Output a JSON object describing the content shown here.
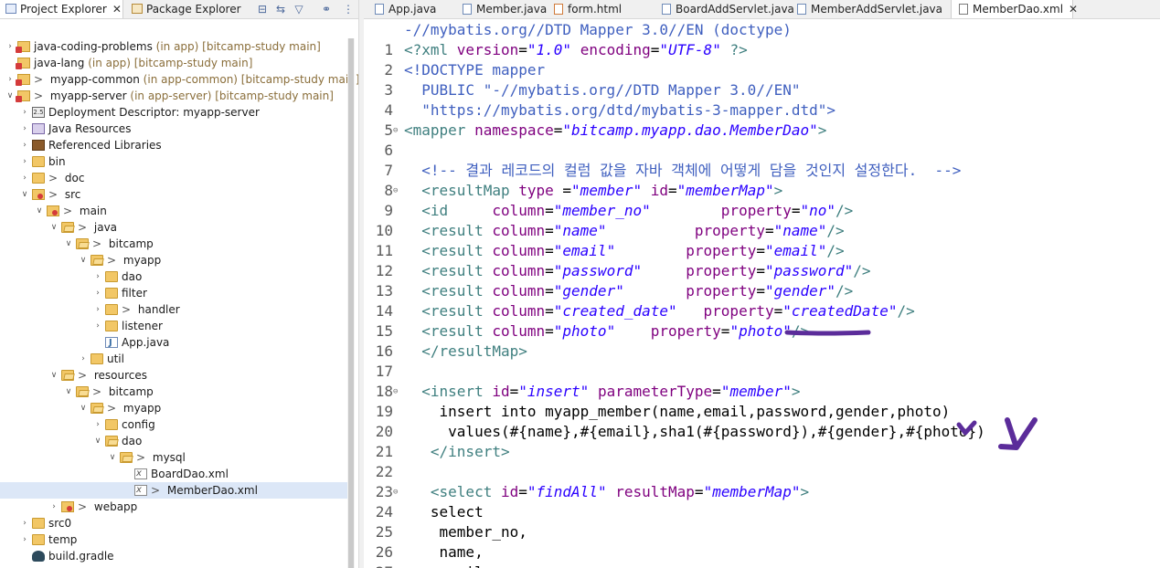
{
  "left_tabs": {
    "project_explorer": "Project Explorer",
    "package_explorer": "Package Explorer",
    "close": "✕"
  },
  "tree": [
    {
      "label": "java-coding-problems",
      "deco": " (in app) [bitcamp-study main]",
      "icon": "project-icon",
      "expand": "collapsed",
      "depth": 0,
      "prefix": ""
    },
    {
      "label": "java-lang",
      "deco": " (in app) [bitcamp-study main]",
      "icon": "project-icon",
      "expand": "none",
      "depth": 0,
      "prefix": ""
    },
    {
      "label": "myapp-common",
      "deco": " (in app-common) [bitcamp-study main]",
      "icon": "project-icon",
      "expand": "collapsed",
      "depth": 0,
      "prefix": "> "
    },
    {
      "label": "myapp-server",
      "deco": " (in app-server) [bitcamp-study main]",
      "icon": "project-icon",
      "expand": "expanded",
      "depth": 0,
      "prefix": "> "
    },
    {
      "label": "Deployment Descriptor: myapp-server",
      "deco": "",
      "icon": "deployment-descriptor-icon",
      "expand": "collapsed",
      "depth": 1,
      "prefix": ""
    },
    {
      "label": "Java Resources",
      "deco": "",
      "icon": "java-resources-icon",
      "expand": "collapsed",
      "depth": 1,
      "prefix": ""
    },
    {
      "label": "Referenced Libraries",
      "deco": "",
      "icon": "library-icon",
      "expand": "collapsed",
      "depth": 1,
      "prefix": ""
    },
    {
      "label": "bin",
      "deco": "",
      "icon": "folder-icon",
      "expand": "collapsed",
      "depth": 1,
      "prefix": ""
    },
    {
      "label": "doc",
      "deco": "",
      "icon": "folder-icon",
      "expand": "collapsed",
      "depth": 1,
      "prefix": "> "
    },
    {
      "label": "src",
      "deco": "",
      "icon": "source-folder-icon",
      "expand": "expanded",
      "depth": 1,
      "prefix": "> "
    },
    {
      "label": "main",
      "deco": "",
      "icon": "source-folder-icon",
      "expand": "expanded",
      "depth": 2,
      "prefix": "> "
    },
    {
      "label": "java",
      "deco": "",
      "icon": "folder-open-icon",
      "expand": "expanded",
      "depth": 3,
      "prefix": "> "
    },
    {
      "label": "bitcamp",
      "deco": "",
      "icon": "folder-open-icon",
      "expand": "expanded",
      "depth": 4,
      "prefix": "> "
    },
    {
      "label": "myapp",
      "deco": "",
      "icon": "folder-open-icon",
      "expand": "expanded",
      "depth": 5,
      "prefix": "> "
    },
    {
      "label": "dao",
      "deco": "",
      "icon": "folder-icon",
      "expand": "collapsed",
      "depth": 6,
      "prefix": ""
    },
    {
      "label": "filter",
      "deco": "",
      "icon": "folder-icon",
      "expand": "collapsed",
      "depth": 6,
      "prefix": ""
    },
    {
      "label": "handler",
      "deco": "",
      "icon": "folder-icon",
      "expand": "collapsed",
      "depth": 6,
      "prefix": "> "
    },
    {
      "label": "listener",
      "deco": "",
      "icon": "folder-icon",
      "expand": "collapsed",
      "depth": 6,
      "prefix": ""
    },
    {
      "label": "App.java",
      "deco": "",
      "icon": "java-file-icon",
      "expand": "none",
      "depth": 6,
      "prefix": ""
    },
    {
      "label": "util",
      "deco": "",
      "icon": "folder-icon",
      "expand": "collapsed",
      "depth": 5,
      "prefix": ""
    },
    {
      "label": "resources",
      "deco": "",
      "icon": "folder-open-icon",
      "expand": "expanded",
      "depth": 3,
      "prefix": "> "
    },
    {
      "label": "bitcamp",
      "deco": "",
      "icon": "folder-open-icon",
      "expand": "expanded",
      "depth": 4,
      "prefix": "> "
    },
    {
      "label": "myapp",
      "deco": "",
      "icon": "folder-open-icon",
      "expand": "expanded",
      "depth": 5,
      "prefix": "> "
    },
    {
      "label": "config",
      "deco": "",
      "icon": "folder-icon",
      "expand": "collapsed",
      "depth": 6,
      "prefix": ""
    },
    {
      "label": "dao",
      "deco": "",
      "icon": "folder-open-icon",
      "expand": "expanded",
      "depth": 6,
      "prefix": ""
    },
    {
      "label": "mysql",
      "deco": "",
      "icon": "folder-open-icon",
      "expand": "expanded",
      "depth": 7,
      "prefix": "> "
    },
    {
      "label": "BoardDao.xml",
      "deco": "",
      "icon": "xml-file-icon",
      "expand": "none",
      "depth": 8,
      "prefix": ""
    },
    {
      "label": "MemberDao.xml",
      "deco": "",
      "icon": "xml-file-icon",
      "expand": "none",
      "depth": 8,
      "prefix": "> ",
      "selected": true
    },
    {
      "label": "webapp",
      "deco": "",
      "icon": "source-folder-icon",
      "expand": "collapsed",
      "depth": 3,
      "prefix": "> "
    },
    {
      "label": "src0",
      "deco": "",
      "icon": "folder-icon",
      "expand": "collapsed",
      "depth": 1,
      "prefix": ""
    },
    {
      "label": "temp",
      "deco": "",
      "icon": "folder-icon",
      "expand": "collapsed",
      "depth": 1,
      "prefix": ""
    },
    {
      "label": "build.gradle",
      "deco": "",
      "icon": "gradle-file-icon",
      "expand": "none",
      "depth": 1,
      "prefix": ""
    }
  ],
  "editor_tabs": [
    {
      "label": "App.java",
      "type": "java",
      "active": false
    },
    {
      "label": "Member.java",
      "type": "java",
      "active": false
    },
    {
      "label": "form.html",
      "type": "html",
      "active": false
    },
    {
      "label": "BoardAddServlet.java",
      "type": "java",
      "active": false
    },
    {
      "label": "MemberAddServlet.java",
      "type": "java",
      "active": false
    },
    {
      "label": "MemberDao.xml",
      "type": "xml",
      "active": true
    }
  ],
  "editor_tab_close": "✕",
  "sticky_header": "-//mybatis.org//DTD Mapper 3.0//EN (doctype)",
  "code_lines": [
    {
      "n": "1",
      "fold": "",
      "segs": [
        [
          "tag",
          "<?xml "
        ],
        [
          "attr",
          "version"
        ],
        [
          "txt",
          "="
        ],
        [
          "val",
          "\"1.0\""
        ],
        [
          "txt",
          " "
        ],
        [
          "attr",
          "encoding"
        ],
        [
          "txt",
          "="
        ],
        [
          "val",
          "\"UTF-8\""
        ],
        [
          "tag",
          " ?>"
        ]
      ]
    },
    {
      "n": "2",
      "fold": "",
      "segs": [
        [
          "dt",
          "<!DOCTYPE mapper"
        ]
      ]
    },
    {
      "n": "3",
      "fold": "",
      "segs": [
        [
          "dt",
          "  PUBLIC \"-//mybatis.org//DTD Mapper 3.0//EN\""
        ]
      ]
    },
    {
      "n": "4",
      "fold": "",
      "segs": [
        [
          "dt",
          "  \"https://mybatis.org/dtd/mybatis-3-mapper.dtd\">"
        ]
      ]
    },
    {
      "n": "5",
      "fold": "⊖",
      "segs": [
        [
          "tag",
          "<mapper "
        ],
        [
          "attr",
          "namespace"
        ],
        [
          "txt",
          "="
        ],
        [
          "val",
          "\"bitcamp.myapp.dao.MemberDao\""
        ],
        [
          "tag",
          ">"
        ]
      ]
    },
    {
      "n": "6",
      "fold": "",
      "segs": [
        [
          "txt",
          ""
        ]
      ]
    },
    {
      "n": "7",
      "fold": "",
      "segs": [
        [
          "cm",
          "  <!-- 결과 레코드의 컬럼 값을 자바 객체에 어떻게 담을 것인지 설정한다.  -->"
        ]
      ]
    },
    {
      "n": "8",
      "fold": "⊖",
      "segs": [
        [
          "tag",
          "  <resultMap "
        ],
        [
          "attr",
          "type "
        ],
        [
          "txt",
          "="
        ],
        [
          "val",
          "\"member\""
        ],
        [
          "txt",
          " "
        ],
        [
          "attr",
          "id"
        ],
        [
          "txt",
          "="
        ],
        [
          "val",
          "\"memberMap\""
        ],
        [
          "tag",
          ">"
        ]
      ]
    },
    {
      "n": "9",
      "fold": "",
      "segs": [
        [
          "tag",
          "  <id     "
        ],
        [
          "attr",
          "column"
        ],
        [
          "txt",
          "="
        ],
        [
          "val",
          "\"member_no\""
        ],
        [
          "txt",
          "        "
        ],
        [
          "attr",
          "property"
        ],
        [
          "txt",
          "="
        ],
        [
          "val",
          "\"no\""
        ],
        [
          "tag",
          "/>"
        ]
      ]
    },
    {
      "n": "10",
      "fold": "",
      "segs": [
        [
          "tag",
          "  <result "
        ],
        [
          "attr",
          "column"
        ],
        [
          "txt",
          "="
        ],
        [
          "val",
          "\"name\""
        ],
        [
          "txt",
          "          "
        ],
        [
          "attr",
          "property"
        ],
        [
          "txt",
          "="
        ],
        [
          "val",
          "\"name\""
        ],
        [
          "tag",
          "/>"
        ]
      ]
    },
    {
      "n": "11",
      "fold": "",
      "segs": [
        [
          "tag",
          "  <result "
        ],
        [
          "attr",
          "column"
        ],
        [
          "txt",
          "="
        ],
        [
          "val",
          "\"email\""
        ],
        [
          "txt",
          "        "
        ],
        [
          "attr",
          "property"
        ],
        [
          "txt",
          "="
        ],
        [
          "val",
          "\"email\""
        ],
        [
          "tag",
          "/>"
        ]
      ]
    },
    {
      "n": "12",
      "fold": "",
      "segs": [
        [
          "tag",
          "  <result "
        ],
        [
          "attr",
          "column"
        ],
        [
          "txt",
          "="
        ],
        [
          "val",
          "\"password\""
        ],
        [
          "txt",
          "     "
        ],
        [
          "attr",
          "property"
        ],
        [
          "txt",
          "="
        ],
        [
          "val",
          "\"password\""
        ],
        [
          "tag",
          "/>"
        ]
      ]
    },
    {
      "n": "13",
      "fold": "",
      "segs": [
        [
          "tag",
          "  <result "
        ],
        [
          "attr",
          "column"
        ],
        [
          "txt",
          "="
        ],
        [
          "val",
          "\"gender\""
        ],
        [
          "txt",
          "       "
        ],
        [
          "attr",
          "property"
        ],
        [
          "txt",
          "="
        ],
        [
          "val",
          "\"gender\""
        ],
        [
          "tag",
          "/>"
        ]
      ]
    },
    {
      "n": "14",
      "fold": "",
      "segs": [
        [
          "tag",
          "  <result "
        ],
        [
          "attr",
          "column"
        ],
        [
          "txt",
          "="
        ],
        [
          "val",
          "\"created_date\""
        ],
        [
          "txt",
          "   "
        ],
        [
          "attr",
          "property"
        ],
        [
          "txt",
          "="
        ],
        [
          "val",
          "\"createdDate\""
        ],
        [
          "tag",
          "/>"
        ]
      ]
    },
    {
      "n": "15",
      "fold": "",
      "segs": [
        [
          "tag",
          "  <result "
        ],
        [
          "attr",
          "column"
        ],
        [
          "txt",
          "="
        ],
        [
          "val",
          "\"photo\""
        ],
        [
          "txt",
          "    "
        ],
        [
          "attr",
          "property"
        ],
        [
          "txt",
          "="
        ],
        [
          "val",
          "\"photo\""
        ],
        [
          "tag",
          "/>"
        ]
      ]
    },
    {
      "n": "16",
      "fold": "",
      "segs": [
        [
          "tag",
          "  </resultMap>"
        ]
      ]
    },
    {
      "n": "17",
      "fold": "",
      "segs": [
        [
          "txt",
          ""
        ]
      ]
    },
    {
      "n": "18",
      "fold": "⊖",
      "segs": [
        [
          "tag",
          "  <insert "
        ],
        [
          "attr",
          "id"
        ],
        [
          "txt",
          "="
        ],
        [
          "val",
          "\"insert\""
        ],
        [
          "txt",
          " "
        ],
        [
          "attr",
          "parameterType"
        ],
        [
          "txt",
          "="
        ],
        [
          "val",
          "\"member\""
        ],
        [
          "tag",
          ">"
        ]
      ]
    },
    {
      "n": "19",
      "fold": "",
      "segs": [
        [
          "txt",
          "    insert into myapp_member(name,email,password,gender,photo)"
        ]
      ]
    },
    {
      "n": "20",
      "fold": "",
      "segs": [
        [
          "txt",
          "     values(#{name},#{email},sha1(#{password}),#{gender},#{photo})"
        ]
      ]
    },
    {
      "n": "21",
      "fold": "",
      "segs": [
        [
          "tag",
          "   </insert>"
        ]
      ]
    },
    {
      "n": "22",
      "fold": "",
      "segs": [
        [
          "txt",
          ""
        ]
      ]
    },
    {
      "n": "23",
      "fold": "⊖",
      "segs": [
        [
          "tag",
          "   <select "
        ],
        [
          "attr",
          "id"
        ],
        [
          "txt",
          "="
        ],
        [
          "val",
          "\"findAll\""
        ],
        [
          "txt",
          " "
        ],
        [
          "attr",
          "resultMap"
        ],
        [
          "txt",
          "="
        ],
        [
          "val",
          "\"memberMap\""
        ],
        [
          "tag",
          ">"
        ]
      ]
    },
    {
      "n": "24",
      "fold": "",
      "segs": [
        [
          "txt",
          "   select"
        ]
      ]
    },
    {
      "n": "25",
      "fold": "",
      "segs": [
        [
          "txt",
          "    member_no,"
        ]
      ]
    },
    {
      "n": "26",
      "fold": "",
      "segs": [
        [
          "txt",
          "    name,"
        ]
      ]
    },
    {
      "n": "27",
      "fold": "",
      "segs": [
        [
          "txt",
          "    email,"
        ]
      ]
    }
  ],
  "colors": {
    "tag": "#3f7f7f",
    "attr": "#7f007f",
    "value": "#2a00ff",
    "doctype": "#3f5fbf",
    "comment": "#3f5fbf",
    "annotation_ink": "#5b2c9a",
    "selection": "#dce7f7"
  }
}
